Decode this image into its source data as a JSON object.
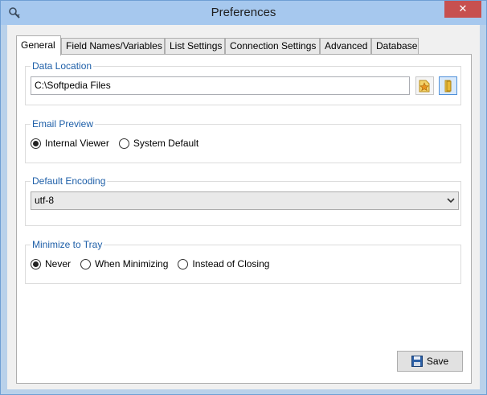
{
  "window": {
    "title": "Preferences",
    "close_glyph": "✕",
    "app_icon": "magnifier-key-icon"
  },
  "tabs": [
    {
      "label": "General",
      "active": true
    },
    {
      "label": "Field Names/Variables",
      "active": false
    },
    {
      "label": "List Settings",
      "active": false
    },
    {
      "label": "Connection Settings",
      "active": false
    },
    {
      "label": "Advanced",
      "active": false
    },
    {
      "label": "Database",
      "active": false
    }
  ],
  "data_location": {
    "title": "Data Location",
    "path_value": "C:\\Softpedia Files",
    "buttons": [
      {
        "icon": "folder-star-icon"
      },
      {
        "icon": "folder-open-icon"
      }
    ]
  },
  "email_preview": {
    "title": "Email Preview",
    "options": [
      {
        "label": "Internal Viewer",
        "selected": true
      },
      {
        "label": "System Default",
        "selected": false
      }
    ]
  },
  "default_encoding": {
    "title": "Default Encoding",
    "selected_value": "utf-8"
  },
  "minimize_to_tray": {
    "title": "Minimize to Tray",
    "options": [
      {
        "label": "Never",
        "selected": true
      },
      {
        "label": "When Minimizing",
        "selected": false
      },
      {
        "label": "Instead of Closing",
        "selected": false
      }
    ]
  },
  "footer": {
    "save_label": "Save",
    "save_icon": "floppy-disk-icon"
  },
  "colors": {
    "titlebar": "#a6c8ee",
    "close": "#c7504f",
    "group_title": "#1e5fa8"
  }
}
